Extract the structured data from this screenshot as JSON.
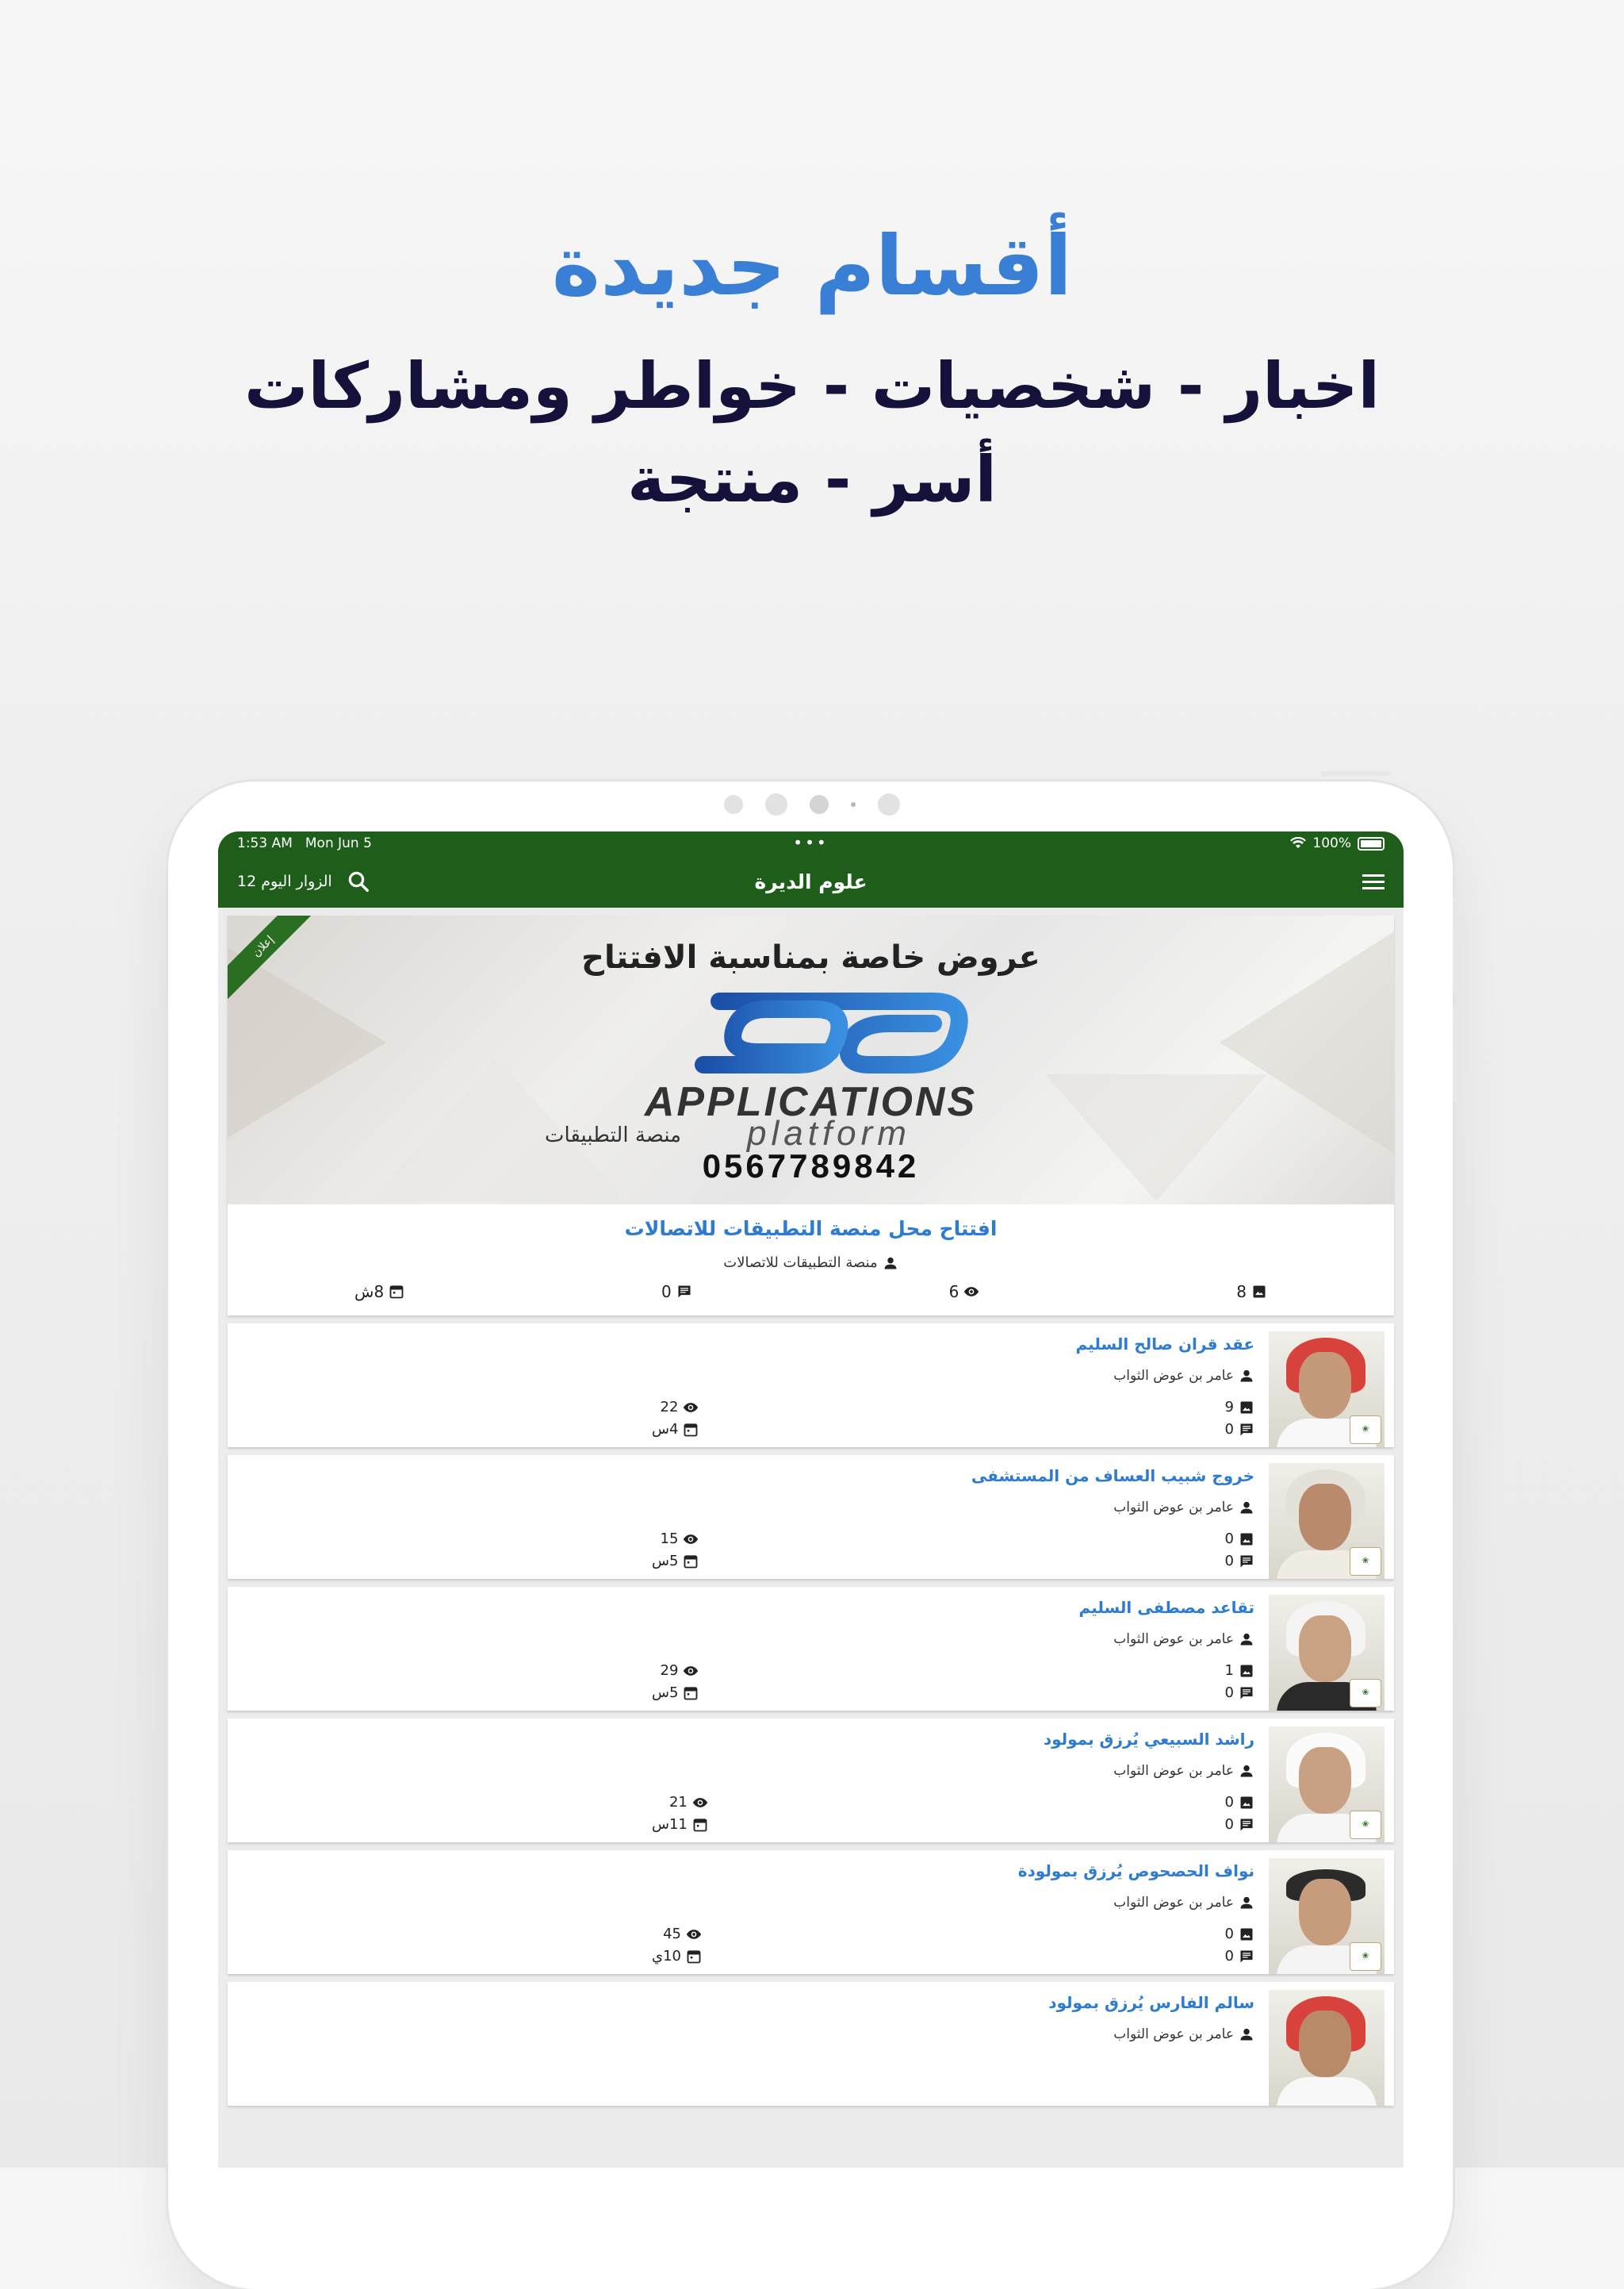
{
  "promo": {
    "heading": "أقسام جديدة",
    "subheading": "اخبار - شخصيات - خواطر ومشاركات أسر - منتجة"
  },
  "status_bar": {
    "time": "1:53 AM",
    "date": "Mon Jun 5",
    "battery": "100%"
  },
  "app_bar": {
    "title": "علوم الديرة",
    "visitors": "الزوار اليوم 12"
  },
  "featured": {
    "ribbon": "إعلان",
    "banner": {
      "headline": "عروض خاصة بمناسبة الافتتاح",
      "brand": "APPLICATIONS",
      "brand_sub": "platform",
      "brand_ar": "منصة التطبيقات",
      "phone": "0567789842"
    },
    "title": "افتتاح محل منصة التطبيقات للاتصالات",
    "author": "منصة التطبيقات للاتصالات",
    "images": "8",
    "views": "6",
    "comments": "0",
    "age": "8ش"
  },
  "posts": [
    {
      "title": "عقد قران صالح السليم",
      "author": "عامر بن عوض الثواب",
      "images": "9",
      "comments": "0",
      "views": "22",
      "age": "4س"
    },
    {
      "title": "خروج شبيب العساف من المستشفى",
      "author": "عامر بن عوض الثواب",
      "images": "0",
      "comments": "0",
      "views": "15",
      "age": "5س"
    },
    {
      "title": "تقاعد مصطفى السليم",
      "author": "عامر بن عوض الثواب",
      "images": "1",
      "comments": "0",
      "views": "29",
      "age": "5س"
    },
    {
      "title": "راشد السبيعي يُرزق بمولود",
      "author": "عامر بن عوض الثواب",
      "images": "0",
      "comments": "0",
      "views": "21",
      "age": "11س"
    },
    {
      "title": "نواف الحصحوص يُرزق بمولودة",
      "author": "عامر بن عوض الثواب",
      "images": "0",
      "comments": "0",
      "views": "45",
      "age": "10ي"
    },
    {
      "title": "سالم الفارس يُرزق بمولود",
      "author": "عامر بن عوض الثواب",
      "images": "",
      "comments": "",
      "views": "",
      "age": ""
    }
  ],
  "colors": {
    "brand_green": "#1e5e1a",
    "title_blue": "#2e7bd2",
    "promo_blue": "#3a7fd6",
    "promo_dark": "#14123a"
  },
  "icons": [
    "search-icon",
    "menu-icon",
    "wifi-icon",
    "battery-icon",
    "person-icon",
    "image-icon",
    "eye-icon",
    "comment-icon",
    "calendar-icon"
  ]
}
